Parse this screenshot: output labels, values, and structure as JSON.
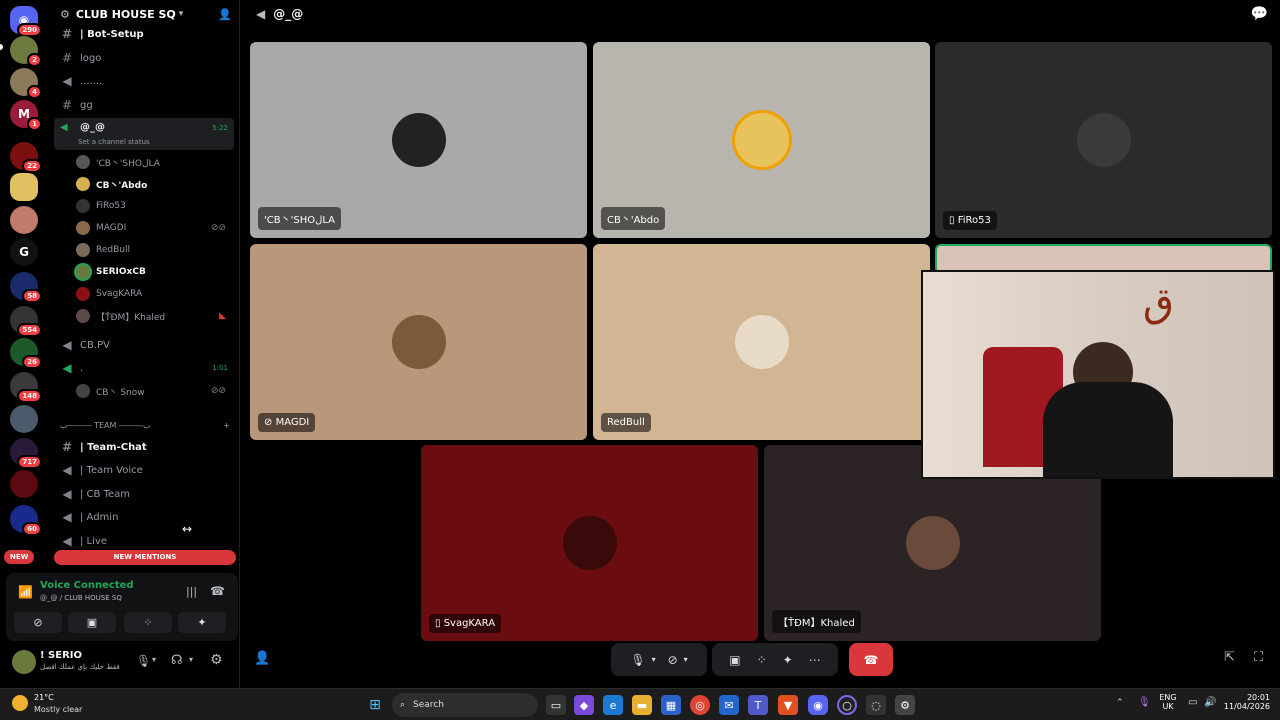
{
  "server_rail": {
    "badges": [
      "290",
      "2",
      "4",
      "1",
      "22",
      "58",
      "554",
      "26",
      "148",
      "717",
      "60"
    ],
    "server_letter": "G",
    "new_label": "NEW"
  },
  "server": {
    "name": "CLUB HOUSE SQ"
  },
  "channels": {
    "bot_setup": "| Bot-Setup",
    "logo": "logo",
    "dots": ".......",
    "gg": "gg",
    "active_voice": "@_@",
    "active_timer": "5:22",
    "channel_status": "Set a channel status",
    "voice_users": [
      {
        "name": "'CB丶'SHOلLA"
      },
      {
        "name": "CB丶'Abdo"
      },
      {
        "name": "FiRo53"
      },
      {
        "name": "MAGDI"
      },
      {
        "name": "RedBull"
      },
      {
        "name": "SERIOxCB"
      },
      {
        "name": "SvagKARA"
      },
      {
        "name": "【ŤĐM】Khaled"
      }
    ],
    "cbpv": "CB.PV",
    "dot_channel": ".",
    "dot_timer": "1:01",
    "dot_user": "CB丶 Snow",
    "team_category": "ب――― TEAM ―――ب",
    "team_chat": "| Team-Chat",
    "team_voice": "| Team Voice",
    "cb_team": "| CB Team",
    "admin": "| Admin",
    "live": "| Live",
    "new_mentions": "NEW MENTIONS"
  },
  "voice_panel": {
    "status": "Voice Connected",
    "location": "@_@ / CLUB HOUSE SQ"
  },
  "user_panel": {
    "name": "! SERIO",
    "status": "فقط خليك بإي عملك افضل"
  },
  "topbar": {
    "channel_name": "@_@"
  },
  "tiles": [
    {
      "label": "'CB丶'SHOلLA",
      "bg": "#a9a9a9"
    },
    {
      "label": "CB丶'Abdo",
      "bg": "#b8b5ae"
    },
    {
      "label": "FiRo53",
      "bg": "#2b2b2b"
    },
    {
      "label": "MAGDI",
      "bg": "#b9977a"
    },
    {
      "label": "RedBull",
      "bg": "#d2b593"
    },
    {
      "label": "SvagKARA",
      "bg": "#6a0c10"
    },
    {
      "label": "【ŤĐM】Khaled",
      "bg": "#2c2424"
    }
  ],
  "taskbar": {
    "weather_temp": "21°C",
    "weather_desc": "Mostly clear",
    "search_placeholder": "Search",
    "lang1": "ENG",
    "lang2": "UK",
    "time": "20:01",
    "date": "11/04/2026"
  },
  "colors": {
    "accent_green": "#23a55a",
    "danger_red": "#da373c"
  }
}
